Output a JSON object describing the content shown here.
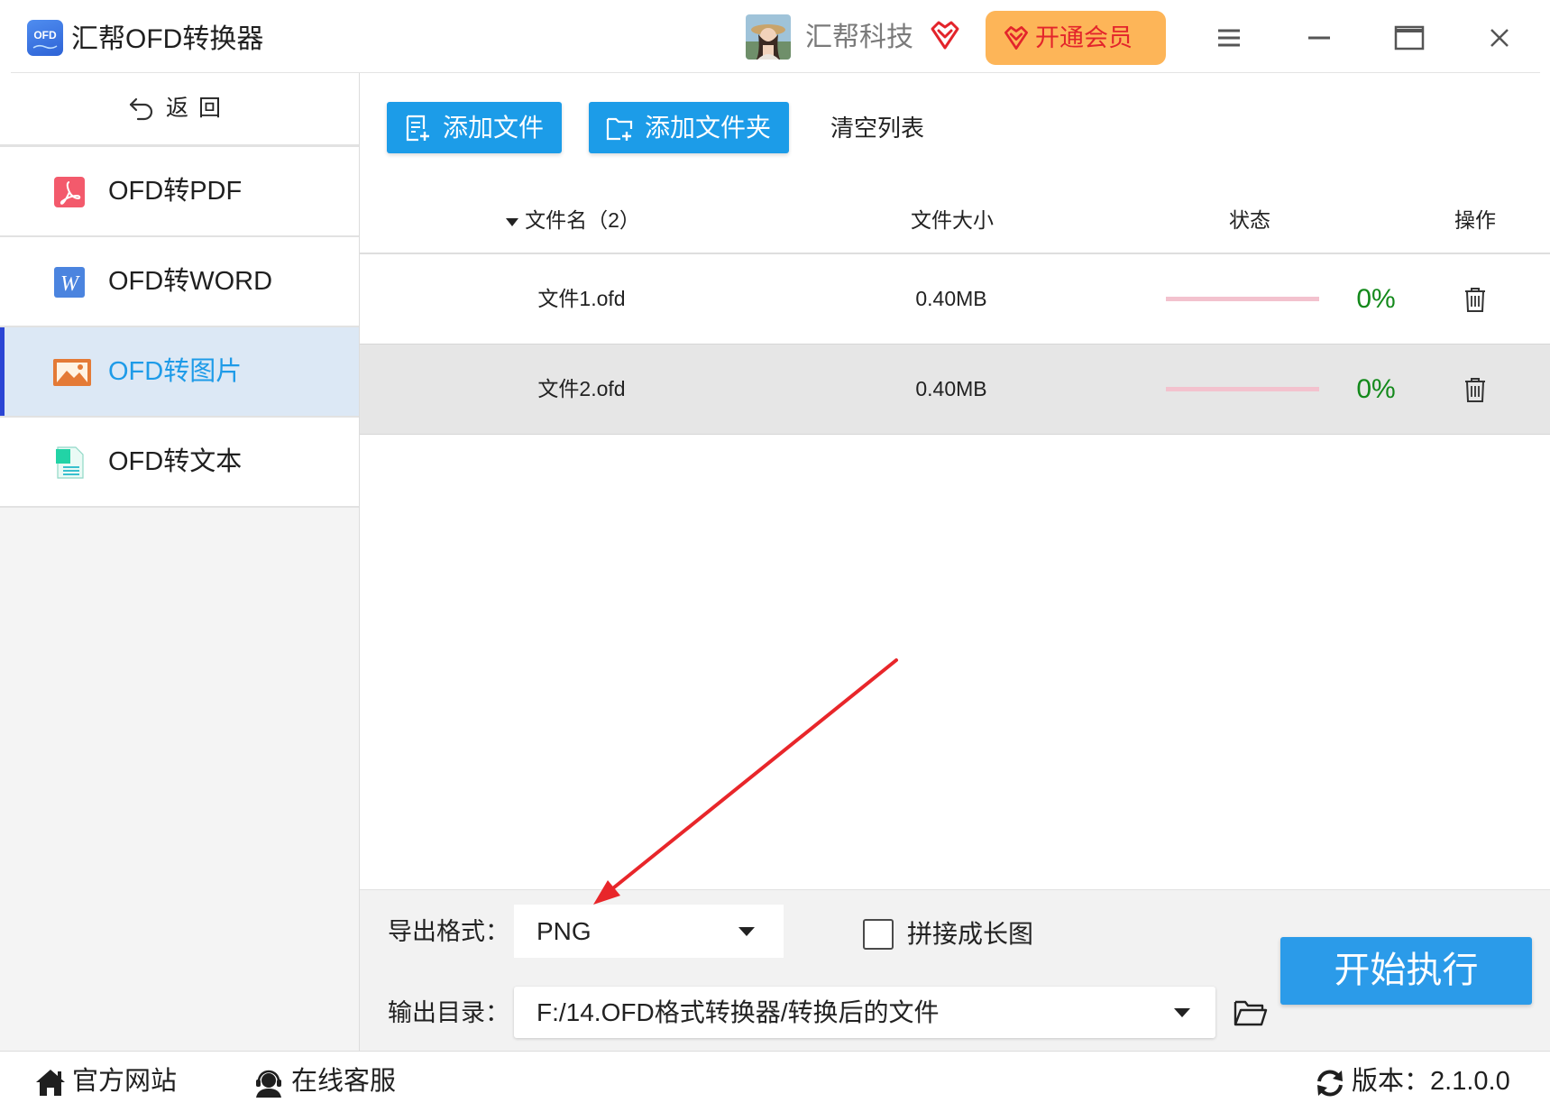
{
  "window": {
    "title": "汇帮OFD转换器",
    "logo_text": "OFD",
    "brand": "汇帮科技",
    "vip_label": "开通会员"
  },
  "colors": {
    "accent": "#1c9ce8",
    "start_button": "#2b9be9",
    "vip_background": "#fdb558",
    "vip_text": "#e3242b",
    "selected_item_background": "#dce8f5",
    "selected_item_bar": "#2b45d4",
    "progress_track": "#f3c2ce",
    "progress_text": "#13891b",
    "annotation_arrow": "#e8262a"
  },
  "sidebar": {
    "back_label": "返 回",
    "items": [
      {
        "label": "OFD转PDF",
        "icon": "pdf-icon",
        "selected": false
      },
      {
        "label": "OFD转WORD",
        "icon": "word-icon",
        "icon_letter": "W",
        "selected": false
      },
      {
        "label": "OFD转图片",
        "icon": "image-icon",
        "selected": true
      },
      {
        "label": "OFD转文本",
        "icon": "text-doc-icon",
        "selected": false
      }
    ]
  },
  "toolbar": {
    "add_file": "添加文件",
    "add_folder": "添加文件夹",
    "clear_list": "清空列表"
  },
  "table": {
    "headers": {
      "name": "文件名（2）",
      "size": "文件大小",
      "status": "状态",
      "actions": "操作"
    },
    "rows": [
      {
        "name": "文件1.ofd",
        "size": "0.40MB",
        "progress": 0,
        "progress_label": "0%"
      },
      {
        "name": "文件2.ofd",
        "size": "0.40MB",
        "progress": 0,
        "progress_label": "0%"
      }
    ]
  },
  "settings": {
    "format_label": "导出格式：",
    "format_value": "PNG",
    "merge_label": "拼接成长图",
    "merge_checked": false,
    "output_label": "输出目录：",
    "output_path": "F:/14.OFD格式转换器/转换后的文件",
    "start_label": "开始执行"
  },
  "footer": {
    "website": "官方网站",
    "support": "在线客服",
    "version_label": "版本：",
    "version": "2.1.0.0"
  }
}
